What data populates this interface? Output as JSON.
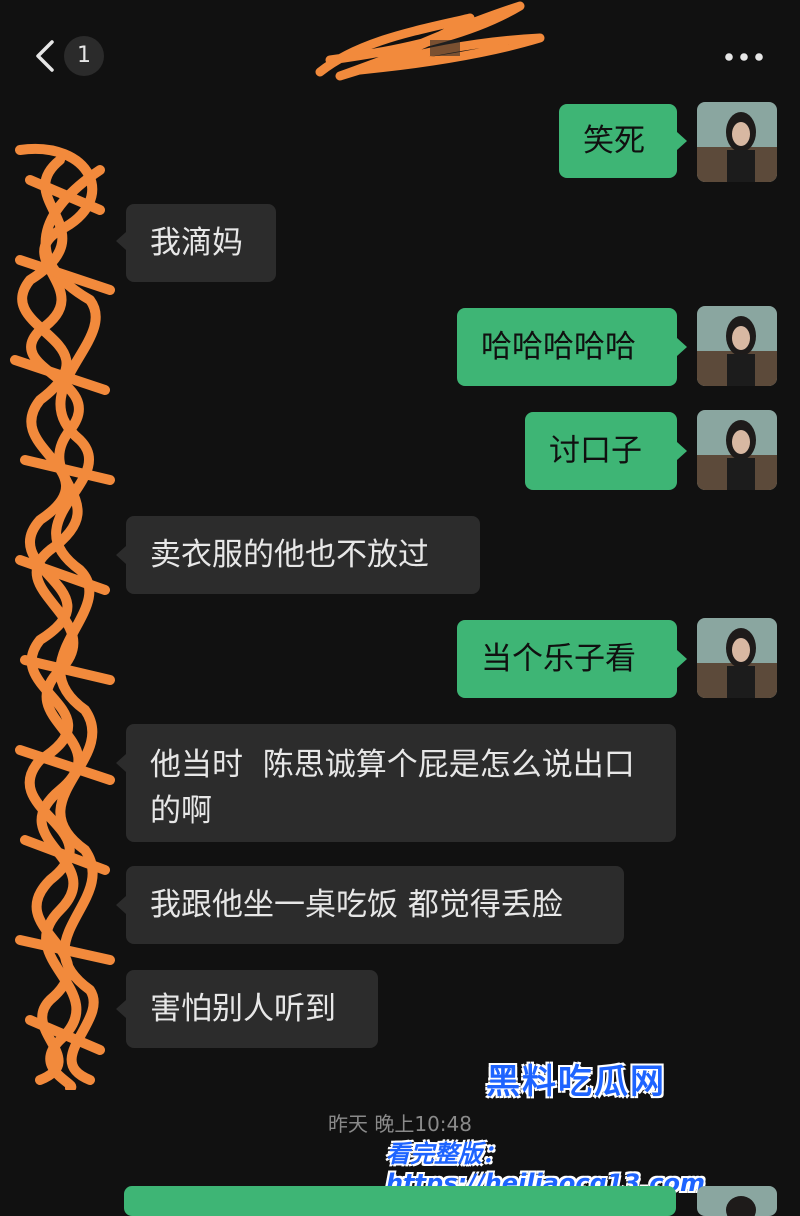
{
  "header": {
    "unread_count": "1"
  },
  "messages": [
    {
      "side": "mine",
      "text": "笑死"
    },
    {
      "side": "theirs",
      "text": "我滴妈"
    },
    {
      "side": "mine",
      "text": "哈哈哈哈哈"
    },
    {
      "side": "mine",
      "text": "讨口子"
    },
    {
      "side": "theirs",
      "text": "卖衣服的他也不放过"
    },
    {
      "side": "mine",
      "text": "当个乐子看"
    },
    {
      "side": "theirs",
      "text": "他当时  陈思诚算个屁是怎么说出口的啊"
    },
    {
      "side": "theirs",
      "text": "我跟他坐一桌吃饭 都觉得丢脸"
    },
    {
      "side": "theirs",
      "text": "害怕别人听到"
    }
  ],
  "timestamp": "昨天 晚上10:48",
  "watermark": {
    "logo": "黑料吃瓜网",
    "url": "看完整版：https://heiliaocg13.com"
  },
  "colors": {
    "background": "#111111",
    "my_bubble": "#3eb575",
    "their_bubble": "#2c2c2c",
    "scribble": "#f28a3c",
    "watermark": "#1e64ff"
  }
}
